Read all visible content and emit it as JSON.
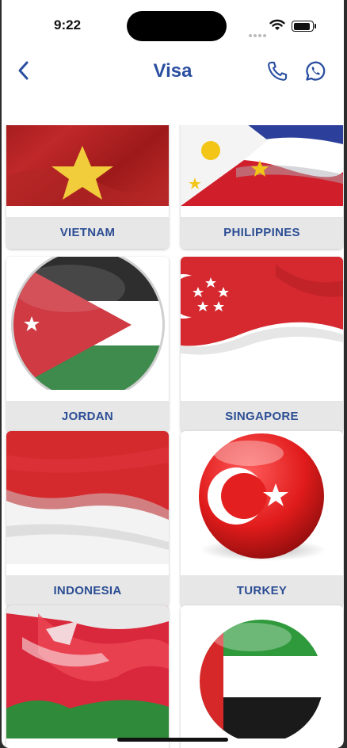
{
  "status_bar": {
    "time": "9:22"
  },
  "header": {
    "title": "Visa"
  },
  "icons": {
    "back": "chevron-left-icon",
    "phone": "phone-icon",
    "whatsapp": "whatsapp-icon"
  },
  "colors": {
    "accent": "#2b4fa0",
    "label_bg": "#e7e7e7"
  },
  "countries": [
    {
      "name": "VIETNAM"
    },
    {
      "name": "PHILIPPINES"
    },
    {
      "name": "JORDAN"
    },
    {
      "name": "SINGAPORE"
    },
    {
      "name": "INDONESIA"
    },
    {
      "name": "TURKEY"
    },
    {
      "name": ""
    },
    {
      "name": ""
    }
  ]
}
